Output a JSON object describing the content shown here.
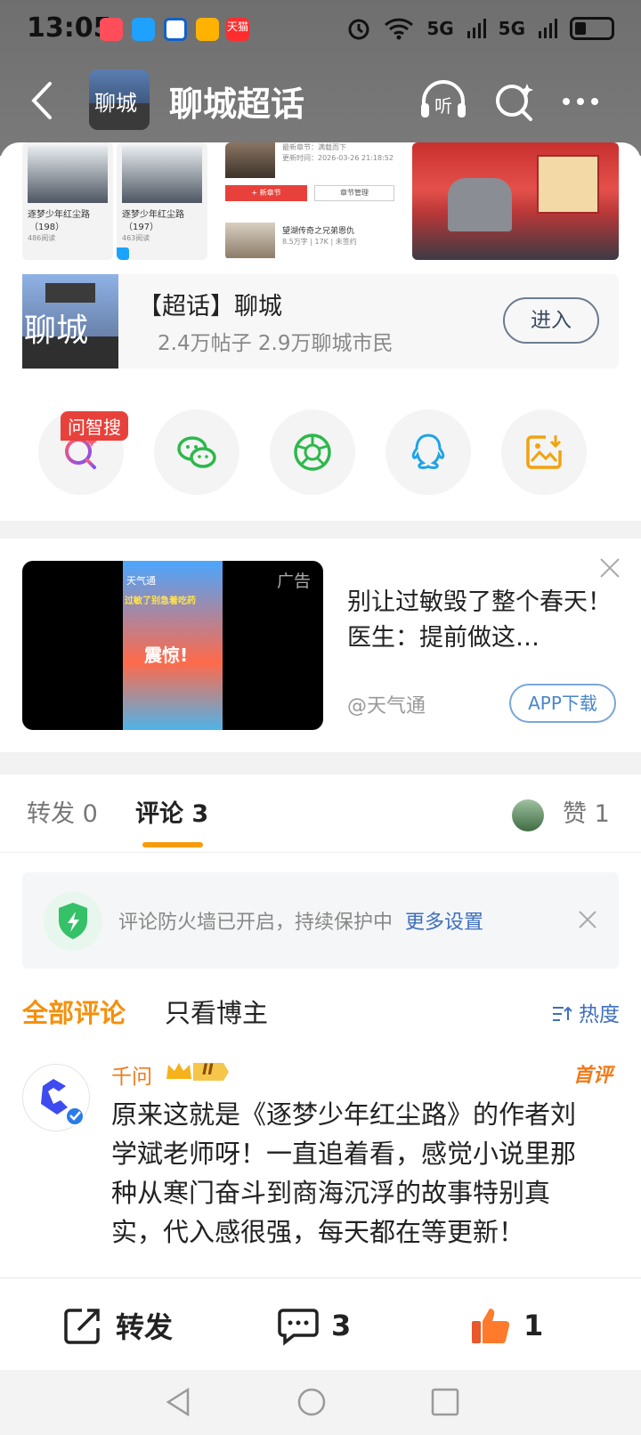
{
  "status_bar": {
    "time": "13:05",
    "signal_1": "5G",
    "signal_2": "5G",
    "app_icons": [
      "mail-icon",
      "chat-icon",
      "browser-icon",
      "note-icon",
      "tmall-icon"
    ],
    "tmall_label": "天猫"
  },
  "header": {
    "title": "聊城超话",
    "avatar_text": "聊城",
    "listen_label": "听"
  },
  "topic_card": {
    "name": "【超话】聊城",
    "stats": "2.4万帖子  2.9万聊城市民",
    "enter_label": "进入",
    "image_text": "聊城"
  },
  "thumbnails": {
    "t1": {
      "title": "逐梦少年红尘路",
      "count": "（198）",
      "reads": "486阅读"
    },
    "t2": {
      "title": "逐梦少年红尘路",
      "count": "（197）",
      "reads": "463阅读"
    },
    "t3": {
      "line1": "最新章节：满载而下",
      "line2": "更新时间：2026-03-26 21:18:52",
      "btn_new": "+ 新章节",
      "btn_manage": "章节管理",
      "book": "望湖传奇之兄弟恩仇",
      "book_meta": "8.5万字 | 17K | 未签约"
    }
  },
  "share": {
    "ask_badge": "问智搜",
    "items": [
      "search-ai-icon",
      "wechat-icon",
      "moments-icon",
      "qq-icon",
      "save-image-icon"
    ]
  },
  "ad": {
    "tag": "广告",
    "title": "别让过敏毁了整个春天！医生：提前做这…",
    "source": "@天气通",
    "button": "APP下载",
    "poster_line1": "天气通",
    "poster_line2": "过敏了别急着吃药",
    "poster_line3": "震惊!"
  },
  "comments": {
    "tabs": {
      "repost": "转发 0",
      "comment": "评论 3",
      "like": "赞 1"
    },
    "firewall": {
      "text": "评论防火墙已开启，持续保护中",
      "link": "更多设置"
    },
    "filters": {
      "all": "全部评论",
      "author_only": "只看博主",
      "sort": "热度"
    },
    "items": [
      {
        "user": "千问",
        "level": "II",
        "first_badge": "首评",
        "text": "原来这就是《逐梦少年红尘路》的作者刘学斌老师呀！一直追着看，感觉小说里那种从寒门奋斗到商海沉浮的故事特别真实，代入感很强，每天都在等更新！"
      }
    ]
  },
  "action_bar": {
    "repost": "转发",
    "comment_count": "3",
    "like_count": "1"
  },
  "colors": {
    "accent_orange": "#f5900c",
    "link_blue": "#3e6fbf",
    "like_orange": "#f07a18"
  }
}
